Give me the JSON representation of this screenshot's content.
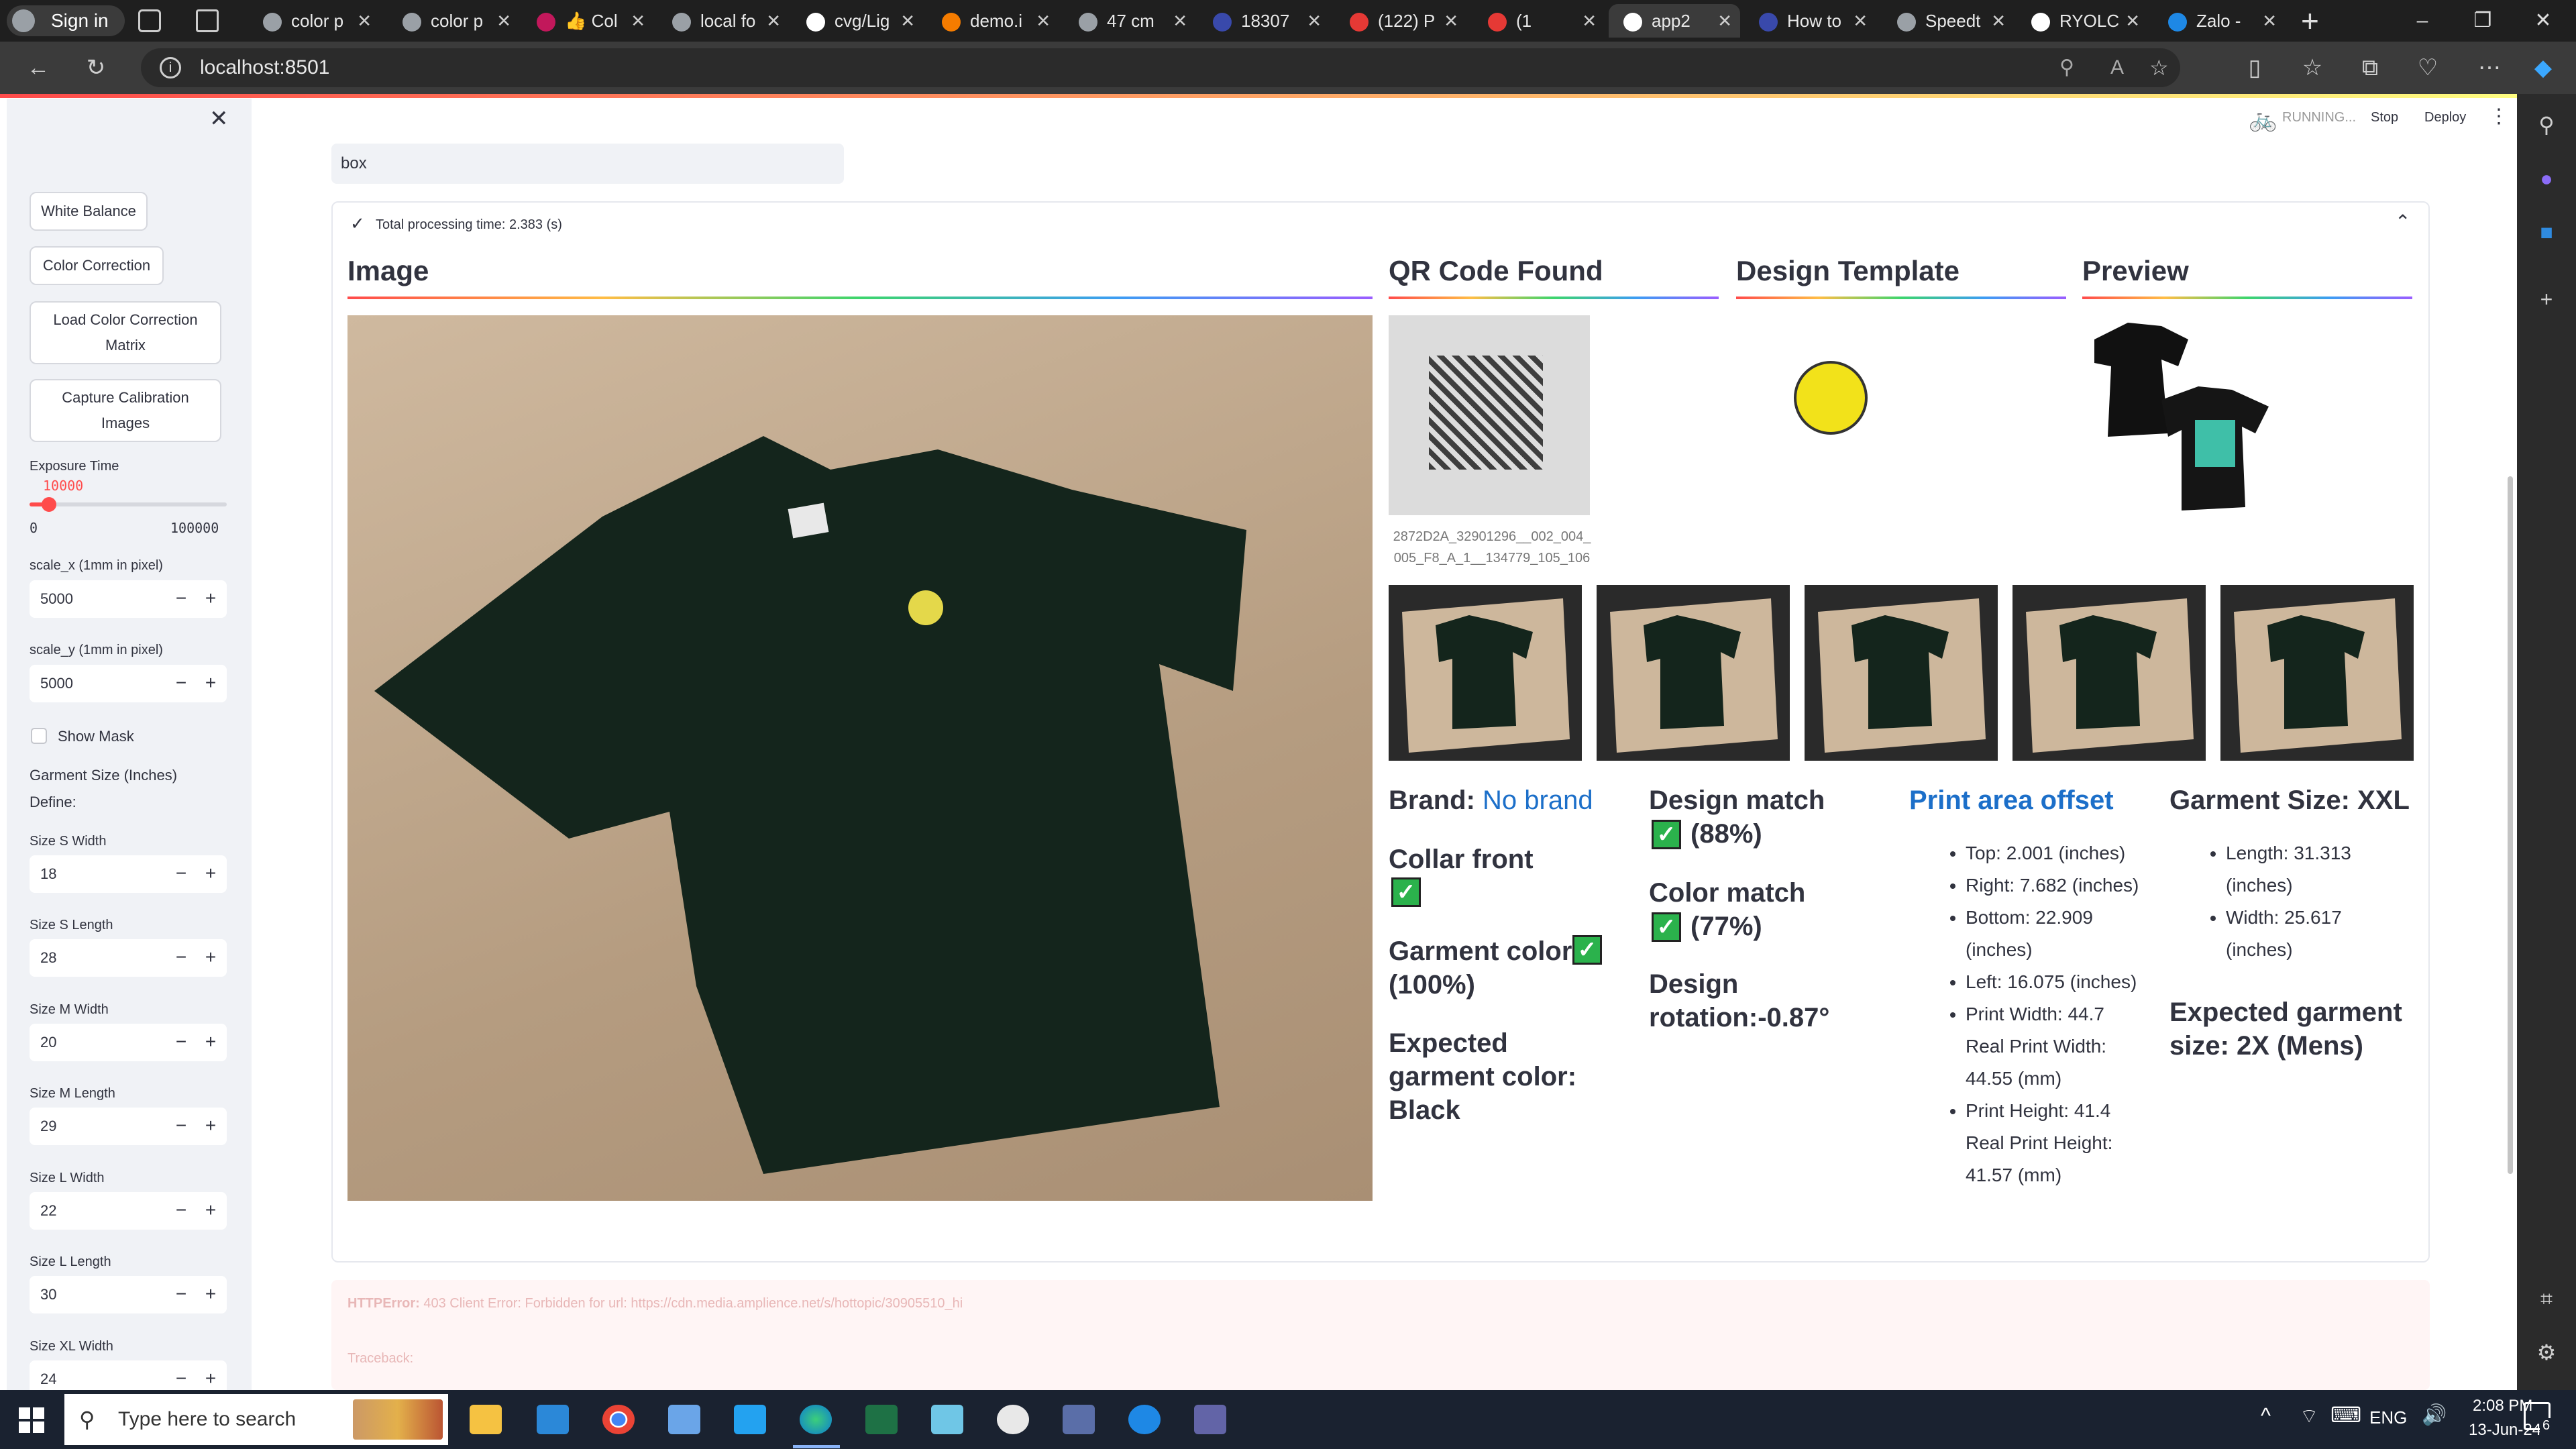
{
  "browser": {
    "profile_label": "Sign in",
    "tabs": [
      {
        "title": "color p",
        "color": "#9aa0a6"
      },
      {
        "title": "color p",
        "color": "#9aa0a6"
      },
      {
        "title": "👍 Col",
        "color": "#c2185b"
      },
      {
        "title": "local fo",
        "color": "#9aa0a6"
      },
      {
        "title": "cvg/Lig",
        "color": "#ffffff"
      },
      {
        "title": "demo.i",
        "color": "#f57c00"
      },
      {
        "title": "47 cm",
        "color": "#9aa0a6"
      },
      {
        "title": "18307",
        "color": "#3949ab"
      },
      {
        "title": "(122) P",
        "color": "#e53935"
      },
      {
        "title": "(1",
        "color": "#e53935"
      },
      {
        "title": "app2",
        "color": "#ffffff"
      },
      {
        "title": "How to",
        "color": "#3949ab"
      },
      {
        "title": "Speedt",
        "color": "#9aa0a6"
      },
      {
        "title": "RYOLC",
        "color": "#ffffff"
      },
      {
        "title": "Zalo -",
        "color": "#1e88e5"
      }
    ],
    "url": "localhost:8501"
  },
  "app": {
    "status": "RUNNING...",
    "stop_label": "Stop",
    "deploy_label": "Deploy",
    "search_value": "box",
    "processing_time": "Total processing time: 2.383 (s)"
  },
  "sidebar": {
    "buttons": [
      "White Balance",
      "Color Correction",
      "Load Color Correction Matrix",
      "Capture Calibration Images"
    ],
    "exposure_label": "Exposure Time",
    "exposure_value": "10000",
    "exposure_min": "0",
    "exposure_max": "100000",
    "exposure_fraction": 0.1,
    "scale_x_label": "scale_x (1mm in pixel)",
    "scale_x_value": "5000",
    "scale_y_label": "scale_y (1mm in pixel)",
    "scale_y_value": "5000",
    "show_mask_label": "Show Mask",
    "garment_size_label": "Garment Size (Inches)",
    "define_label": "Define:",
    "sizes": [
      {
        "label": "Size S Width",
        "value": "18"
      },
      {
        "label": "Size S Length",
        "value": "28"
      },
      {
        "label": "Size M Width",
        "value": "20"
      },
      {
        "label": "Size M Length",
        "value": "29"
      },
      {
        "label": "Size L Width",
        "value": "22"
      },
      {
        "label": "Size L Length",
        "value": "30"
      },
      {
        "label": "Size XL Width",
        "value": "24"
      }
    ]
  },
  "main": {
    "image_header": "Image",
    "qr_header": "QR Code Found",
    "design_header": "Design Template",
    "preview_header": "Preview",
    "qr_caption": "2872D2A_32901296__002_004_005_F8_A_1__134779_105_106",
    "brand_label": "Brand:",
    "brand_value": "No brand",
    "collar_front": "Collar front",
    "garment_color_label": "Garment color:",
    "garment_color_pct": "(100%)",
    "expected_color": "Expected garment color: Black",
    "design_match_label": "Design match",
    "design_match_pct": "(88%)",
    "color_match_label": "Color match",
    "color_match_pct": "(77%)",
    "design_rotation": "Design rotation:-0.87°",
    "print_area_header": "Print area offset",
    "print_area_items": [
      "Top: 2.001 (inches)",
      "Right: 7.682 (inches)",
      "Bottom: 22.909 (inches)",
      "Left: 16.075 (inches)",
      "Print Width: 44.7 Real Print Width: 44.55 (mm)",
      "Print Height: 41.4 Real Print Height: 41.57 (mm)"
    ],
    "garment_size": "Garment Size: XXL",
    "garment_size_items": [
      "Length: 31.313 (inches)",
      "Width: 25.617 (inches)"
    ],
    "expected_size": "Expected garment size: 2X (Mens)",
    "error_title": "HTTPError:",
    "error_message": "403 Client Error: Forbidden for url: https://cdn.media.amplience.net/s/hottopic/30905510_hi",
    "traceback_label": "Traceback:"
  },
  "taskbar": {
    "search_placeholder": "Type here to search",
    "language": "ENG",
    "time": "2:08 PM",
    "date": "13-Jun-24",
    "notification_count": "6"
  }
}
